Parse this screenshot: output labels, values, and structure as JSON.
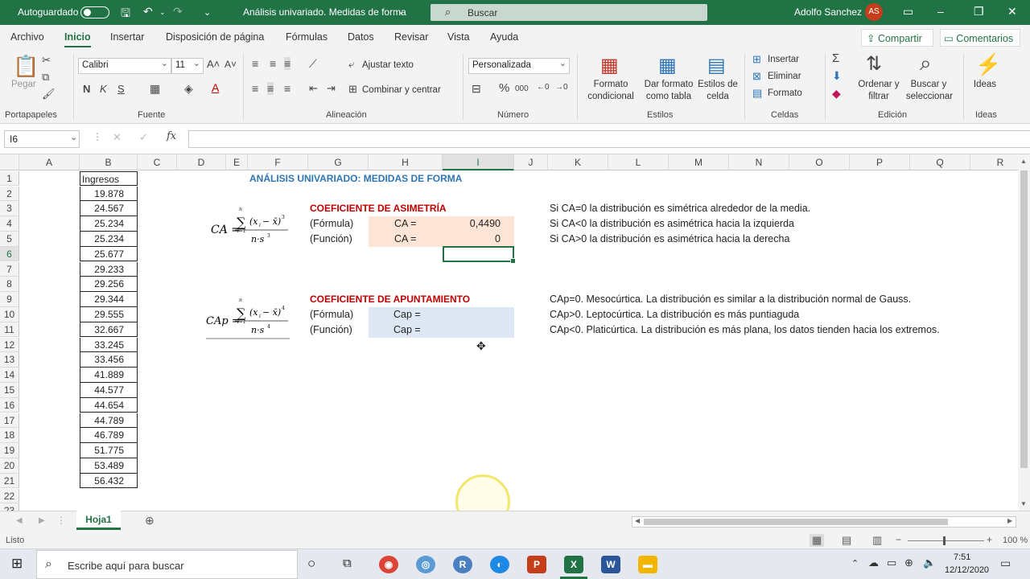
{
  "titlebar": {
    "autosave_label": "Autoguardado",
    "document_title": "Análisis univariado. Medidas de forma",
    "search_placeholder": "Buscar",
    "user_name": "Adolfo Sanchez",
    "user_initials": "AS"
  },
  "menu": {
    "tabs": [
      "Archivo",
      "Inicio",
      "Insertar",
      "Disposición de página",
      "Fórmulas",
      "Datos",
      "Revisar",
      "Vista",
      "Ayuda"
    ],
    "share": "Compartir",
    "comments": "Comentarios"
  },
  "ribbon": {
    "groups": [
      "Portapapeles",
      "Fuente",
      "Alineación",
      "Número",
      "Estilos",
      "Celdas",
      "Edición",
      "Ideas"
    ],
    "paste": "Pegar",
    "font_name": "Calibri",
    "font_size": "11",
    "wrap_text": "Ajustar texto",
    "merge_center": "Combinar y centrar",
    "number_format": "Personalizada",
    "conditional_format": [
      "Formato",
      "condicional"
    ],
    "format_table": [
      "Dar formato",
      "como tabla"
    ],
    "cell_styles": [
      "Estilos de",
      "celda"
    ],
    "insert": "Insertar",
    "delete": "Eliminar",
    "format": "Formato",
    "sort_filter": [
      "Ordenar y",
      "filtrar"
    ],
    "find_select": [
      "Buscar y",
      "seleccionar"
    ],
    "ideas": "Ideas",
    "bold": "N",
    "italic": "K",
    "underline": "S"
  },
  "formula_bar": {
    "name_box": "I6",
    "formula": ""
  },
  "columns": [
    "A",
    "B",
    "C",
    "D",
    "E",
    "F",
    "G",
    "H",
    "I",
    "J",
    "K",
    "L",
    "M",
    "N",
    "O",
    "P",
    "Q",
    "R"
  ],
  "rows": [
    "1",
    "2",
    "3",
    "4",
    "5",
    "6",
    "7",
    "8",
    "9",
    "10",
    "11",
    "12",
    "13",
    "14",
    "15",
    "16",
    "17",
    "18",
    "19",
    "20",
    "21",
    "22",
    "23"
  ],
  "sheet": {
    "ingresos_header": "Ingresos",
    "ingresos": [
      "19.878",
      "24.567",
      "25.234",
      "25.234",
      "25.677",
      "29.233",
      "29.256",
      "29.344",
      "29.555",
      "32.667",
      "33.245",
      "33.456",
      "41.889",
      "44.577",
      "44.654",
      "44.789",
      "46.789",
      "51.775",
      "53.489",
      "56.432"
    ],
    "title": "ANÁLISIS UNIVARIADO: MEDIDAS DE FORMA",
    "asimetria": {
      "heading": "COEFICIENTE DE ASIMETRÍA",
      "formula_label": "(Fórmula)",
      "function_label": "(Función)",
      "ca_label": "CA =",
      "ca_formula_value": "0,4490",
      "ca_function_value": "0",
      "notes": [
        "Si CA=0 la distribución es simétrica alrededor de la media.",
        "Si CA<0 la distribución es asimétrica hacia la izquierda",
        "Si CA>0 la distribución es asimétrica hacia la derecha"
      ]
    },
    "apuntamiento": {
      "heading": "COEFICIENTE DE APUNTAMIENTO",
      "formula_label": "(Fórmula)",
      "function_label": "(Función)",
      "cap_label": "Cap =",
      "notes": [
        "CAp=0. Mesocúrtica. La distribución es similar a la distribución normal de Gauss.",
        "CAp>0. Leptocúrtica. La distribución es más puntiaguda",
        "CAp<0. Platicúrtica. La distribución es más plana, los datos tienden hacia los extremos."
      ]
    }
  },
  "sheet_tabs": [
    "Hoja1"
  ],
  "status": {
    "ready": "Listo",
    "zoom": "100 %"
  },
  "taskbar": {
    "search_placeholder": "Escribe aquí para buscar",
    "time": "7:51",
    "date": "12/12/2020"
  },
  "colors": {
    "excel_green": "#217346",
    "heading_blue": "#2e75b6",
    "heading_red": "#c00000",
    "fill_orange": "#fce4d6",
    "fill_blue": "#dde8f4"
  }
}
